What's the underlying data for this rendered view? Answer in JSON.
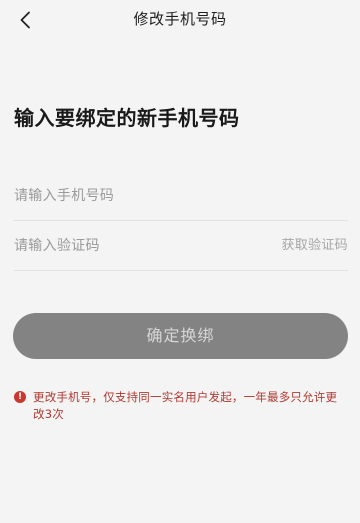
{
  "header": {
    "title": "修改手机号码"
  },
  "heading": "输入要绑定的新手机号码",
  "form": {
    "phone_placeholder": "请输入手机号码",
    "code_placeholder": "请输入验证码",
    "get_code_label": "获取验证码"
  },
  "confirm_label": "确定换绑",
  "notice": {
    "icon_text": "!",
    "text": "更改手机号，仅支持同一实名用户发起，一年最多只允许更改3次"
  },
  "colors": {
    "background": "#f4f4f4",
    "button": "#838383",
    "button_text": "#d6d6d6",
    "warning": "#c8382f"
  },
  "icons": {
    "back": "chevron-left-icon",
    "notice": "exclamation-circle-icon"
  }
}
